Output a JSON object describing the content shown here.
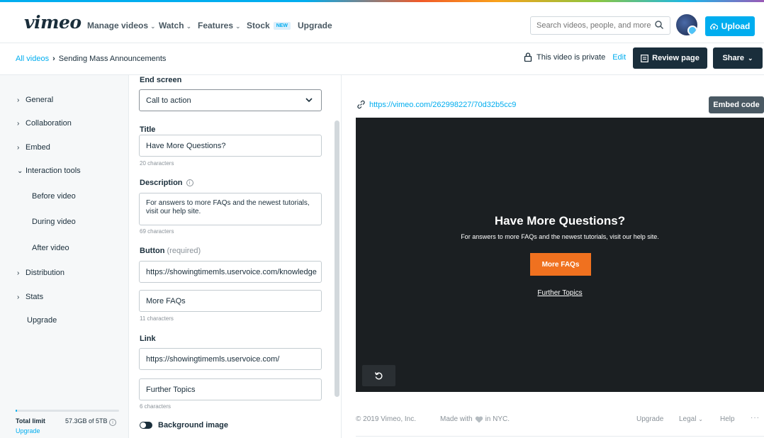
{
  "header": {
    "logo": "vimeo",
    "nav": [
      {
        "label": "Manage videos",
        "chevron": true
      },
      {
        "label": "Watch",
        "chevron": true
      },
      {
        "label": "Features",
        "chevron": true
      },
      {
        "label": "Stock",
        "badge": "NEW"
      },
      {
        "label": "Upgrade"
      }
    ],
    "search_placeholder": "Search videos, people, and more",
    "upload_label": "Upload"
  },
  "subheader": {
    "breadcrumb_root": "All videos",
    "breadcrumb_current": "Sending Mass Announcements",
    "privacy_text": "This video is private",
    "privacy_edit": "Edit",
    "review_label": "Review page",
    "share_label": "Share"
  },
  "sidebar": {
    "items": [
      {
        "label": "General",
        "arrow": "›"
      },
      {
        "label": "Collaboration",
        "arrow": "›"
      },
      {
        "label": "Embed",
        "arrow": "›"
      },
      {
        "label": "Interaction tools",
        "arrow": "⌄"
      },
      {
        "label": "Before video"
      },
      {
        "label": "During video"
      },
      {
        "label": "After video"
      },
      {
        "label": "Distribution",
        "arrow": "›"
      },
      {
        "label": "Stats",
        "arrow": "›"
      },
      {
        "label": "Upgrade"
      }
    ],
    "storage": {
      "label": "Total limit",
      "value": "57.3GB of 5TB",
      "used_fraction": 0.011,
      "upgrade": "Upgrade"
    }
  },
  "form": {
    "end_screen_label": "End screen",
    "end_screen_value": "Call to action",
    "title_label": "Title",
    "title_value": "Have More Questions?",
    "title_count": "20 characters",
    "description_label": "Description",
    "description_value": "For answers to more FAQs and the newest tutorials, visit our help site.",
    "description_count": "69 characters",
    "button_label": "Button",
    "button_required": "(required)",
    "button_url": "https://showingtimemls.uservoice.com/knowledge",
    "button_text": "More FAQs",
    "button_count": "11 characters",
    "link_label": "Link",
    "link_url": "https://showingtimemls.uservoice.com/",
    "link_text": "Further Topics",
    "link_count": "6 characters",
    "background_label": "Background image"
  },
  "preview": {
    "video_url": "https://vimeo.com/262998227/70d32b5cc9",
    "embed_label": "Embed code",
    "end_title": "Have More Questions?",
    "end_description": "For answers to more FAQs and the newest tutorials, visit our help site.",
    "end_button": "More FAQs",
    "end_link": "Further Topics"
  },
  "footer": {
    "copyright": "© 2019 Vimeo, Inc.",
    "made_prefix": "Made with",
    "made_suffix": "in NYC.",
    "upgrade": "Upgrade",
    "legal": "Legal",
    "help": "Help",
    "more": "···"
  },
  "colors": {
    "accent": "#00adef",
    "dark": "#1a2e3b",
    "cta_orange": "#f0711f",
    "player_bg": "#1b1f22"
  }
}
